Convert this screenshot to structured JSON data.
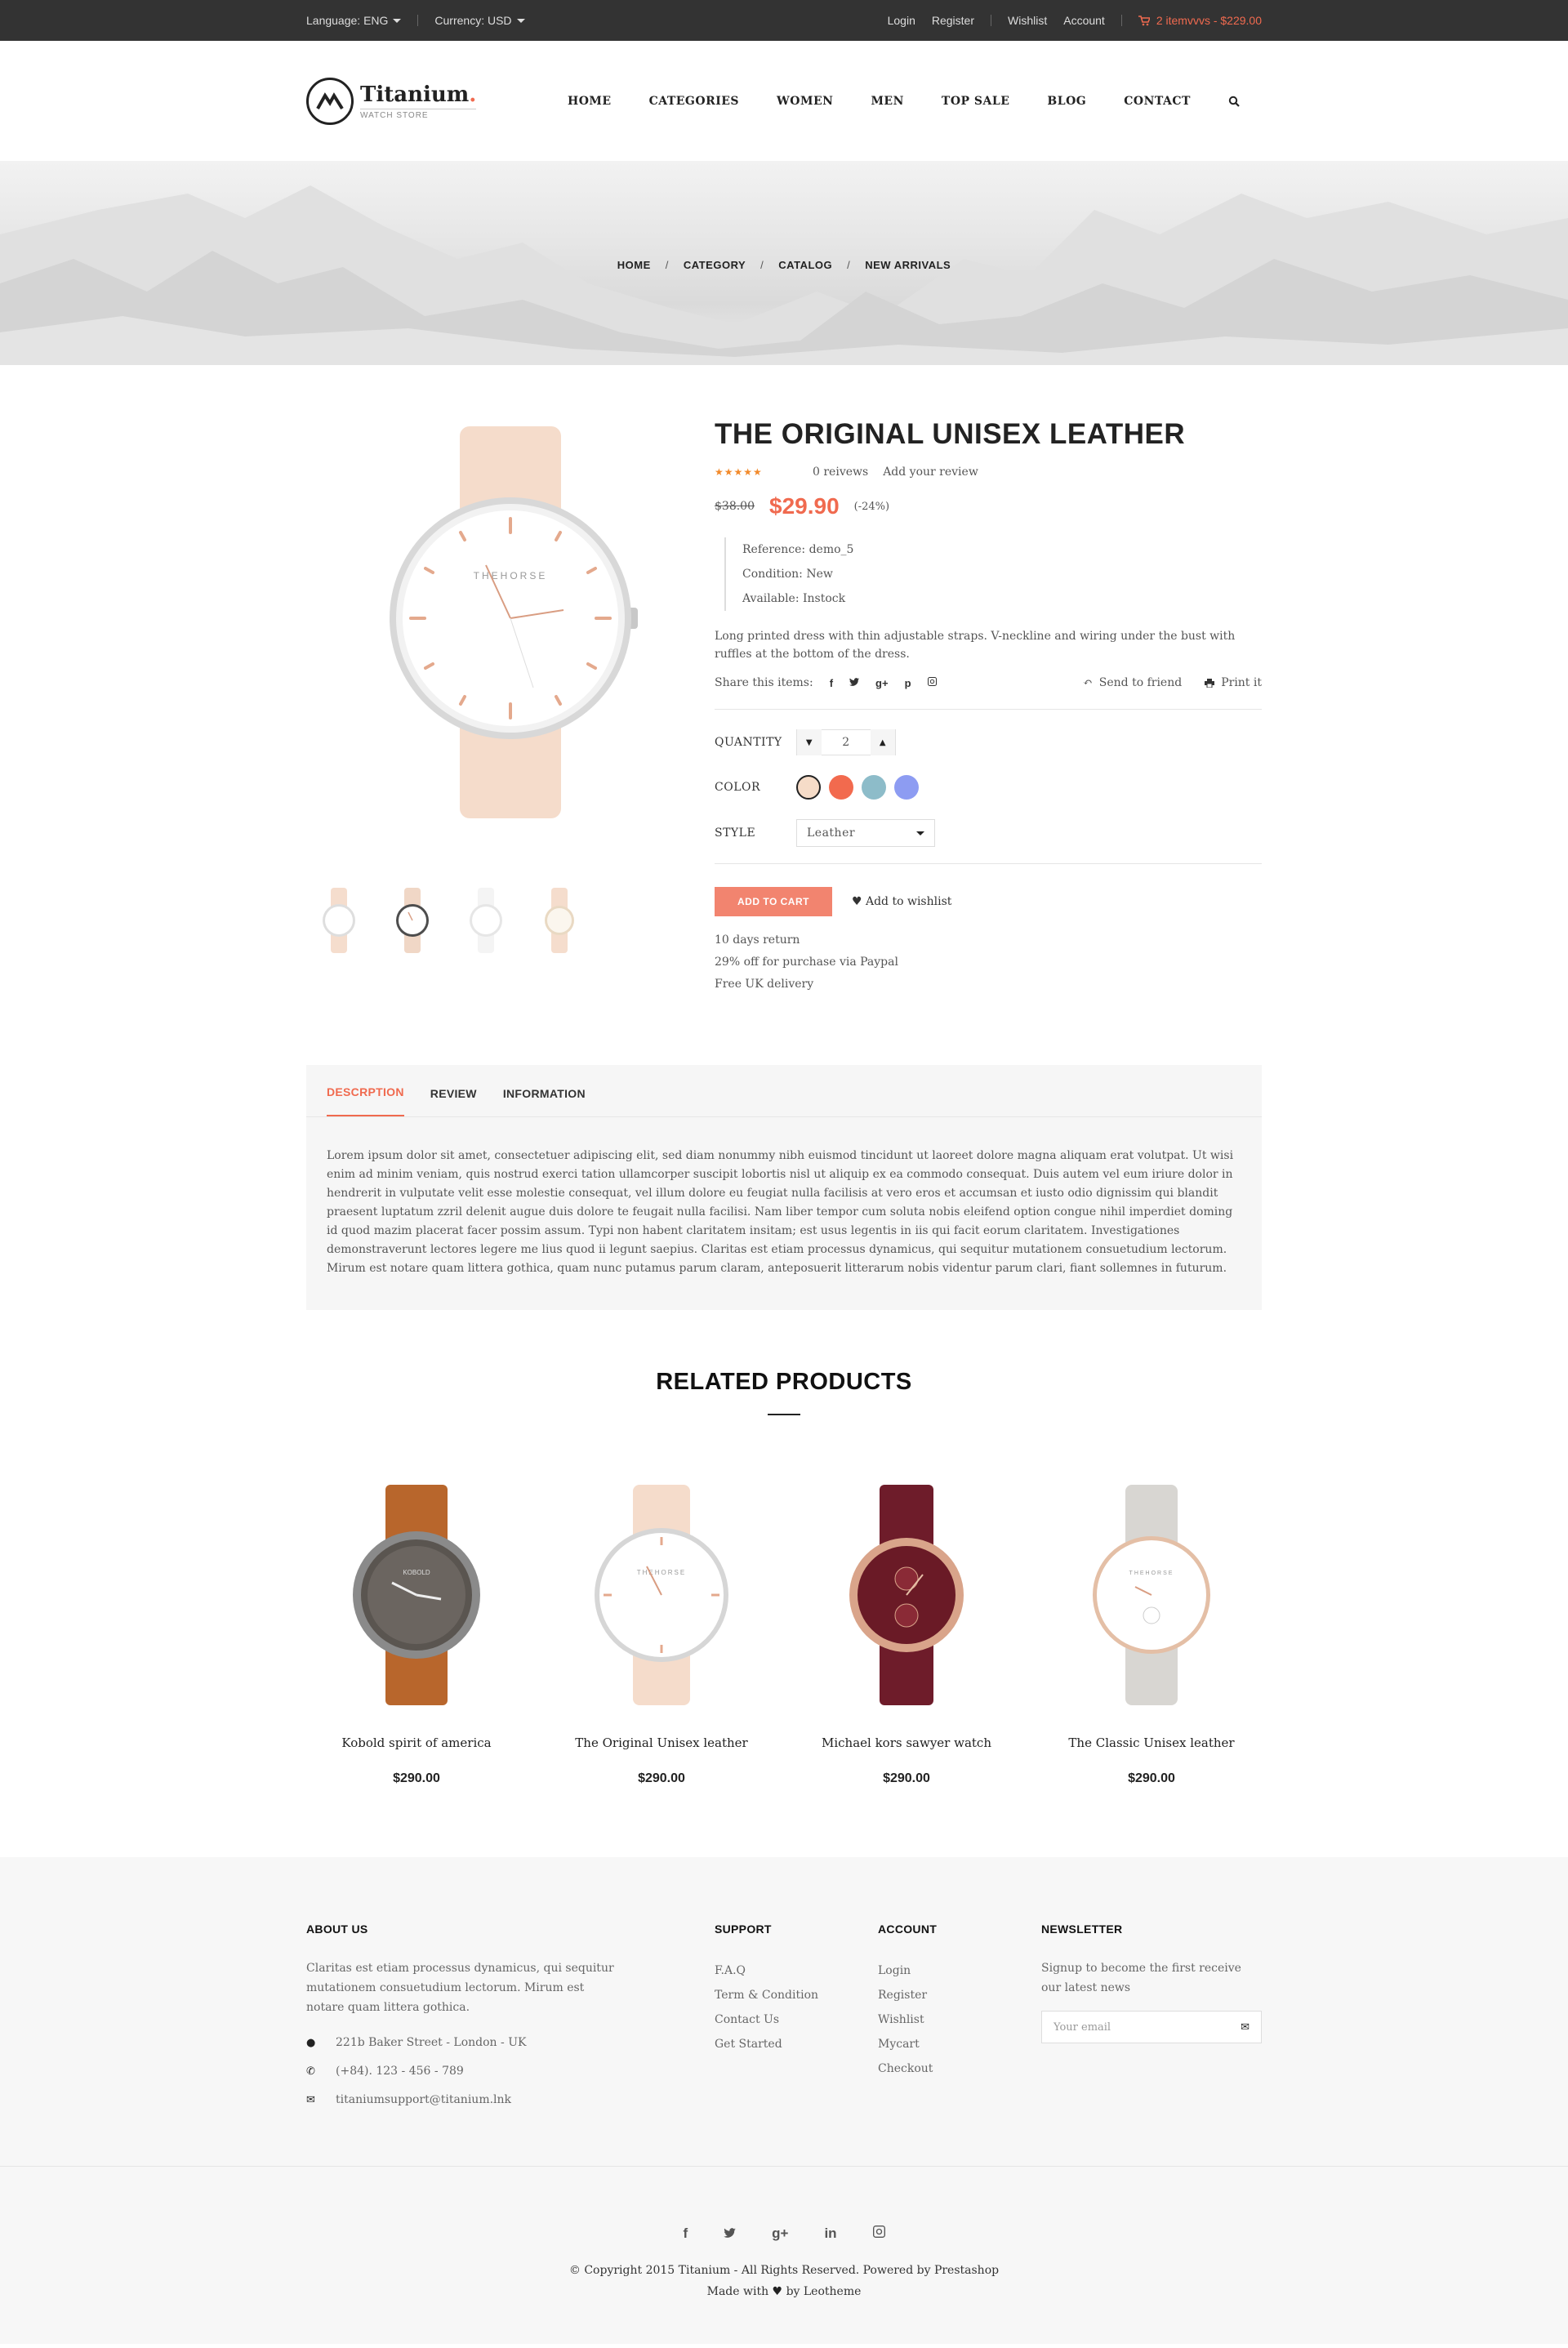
{
  "topbar": {
    "language": "Language: ENG",
    "currency": "Currency: USD",
    "login": "Login",
    "register": "Register",
    "wishlist": "Wishlist",
    "account": "Account",
    "cart": "2 itemvvvs - $229.00"
  },
  "logo": {
    "name": "Titanium",
    "sub": "WATCH STORE"
  },
  "nav": [
    "HOME",
    "CATEGORIES",
    "WOMEN",
    "MEN",
    "TOP SALE",
    "BLOG",
    "CONTACT"
  ],
  "breadcrumb": [
    "HOME",
    "CATEGORY",
    "CATALOG",
    "NEW ARRIVALS"
  ],
  "product": {
    "title": "THE ORIGINAL UNISEX LEATHER",
    "stars": "★★★★★",
    "reviews": "0 reivews",
    "add_review": "Add your review",
    "old_price": "$38.00",
    "price": "$29.90",
    "discount": "(-24%)",
    "reference": "Reference:  demo_5",
    "condition": "Condition:  New",
    "available": "Available: Instock",
    "description": "Long printed dress with thin adjustable straps. V-neckline and wiring under the bust with ruffles at the bottom of the dress.",
    "share_label": "Share this items:",
    "send": "Send to friend",
    "print": "Print it",
    "qty_label": "QUANTITY",
    "qty": "2",
    "color_label": "COLOR",
    "colors": [
      "#f6dcc8",
      "#f26a4e",
      "#8dbcc9",
      "#8d9cf2"
    ],
    "style_label": "STYLE",
    "style": "Leather",
    "add_to_cart": "ADD TO CART",
    "add_to_wishlist": "Add to wishlist",
    "perks": [
      "10 days return",
      "29% off for purchase via Paypal",
      "Free UK delivery"
    ]
  },
  "tabs": {
    "items": [
      "DESCRPTION",
      "REVIEW",
      "INFORMATION"
    ],
    "body": "Lorem ipsum dolor sit amet, consectetuer adipiscing elit, sed diam nonummy nibh euismod tincidunt ut laoreet dolore magna aliquam erat volutpat. Ut wisi enim ad minim veniam, quis nostrud exerci tation ullamcorper suscipit lobortis nisl ut aliquip ex ea commodo consequat. Duis autem vel eum iriure dolor in hendrerit in vulputate velit esse molestie consequat, vel illum dolore eu feugiat nulla facilisis at vero eros et accumsan et iusto odio dignissim qui blandit praesent luptatum zzril delenit augue duis dolore te feugait nulla facilisi. Nam liber tempor cum soluta nobis eleifend option congue nihil imperdiet doming id quod mazim placerat facer possim assum.  Typi non habent claritatem insitam; est usus legentis in iis qui facit eorum claritatem. Investigationes demonstraverunt lectores legere me lius quod ii legunt saepius. Claritas est etiam processus dynamicus, qui sequitur mutationem consuetudium lectorum. Mirum est notare quam littera gothica, quam nunc putamus parum claram, anteposuerit litterarum nobis videntur parum clari, fiant sollemnes in futurum."
  },
  "related": {
    "title": "RELATED PRODUCTS",
    "items": [
      {
        "name": "Kobold spirit of america",
        "price": "$290.00"
      },
      {
        "name": "The Original Unisex leather",
        "price": "$290.00"
      },
      {
        "name": "Michael kors sawyer watch",
        "price": "$290.00"
      },
      {
        "name": "The Classic Unisex leather",
        "price": "$290.00"
      }
    ]
  },
  "footer": {
    "about_title": "ABOUT US",
    "about_text": "Claritas est etiam processus dynamicus, qui sequitur mutationem consuetudium lectorum. Mirum est notare quam littera gothica.",
    "address": "221b Baker Street - London - UK",
    "phone": "(+84). 123 - 456 - 789",
    "email": "titaniumsupport@titanium.lnk",
    "support_title": "SUPPORT",
    "support": [
      "F.A.Q",
      "Term & Condition",
      "Contact Us",
      "Get Started"
    ],
    "account_title": "ACCOUNT",
    "account": [
      "Login",
      "Register",
      "Wishlist",
      "Mycart",
      "Checkout"
    ],
    "news_title": "NEWSLETTER",
    "news_text": "Signup to become the first receive our latest news",
    "email_placeholder": "Your email",
    "copyright": "© Copyright 2015 Titanium - All Rights Reserved. Powered by Prestashop",
    "made_with": "Made with",
    "by": "by Leotheme"
  }
}
